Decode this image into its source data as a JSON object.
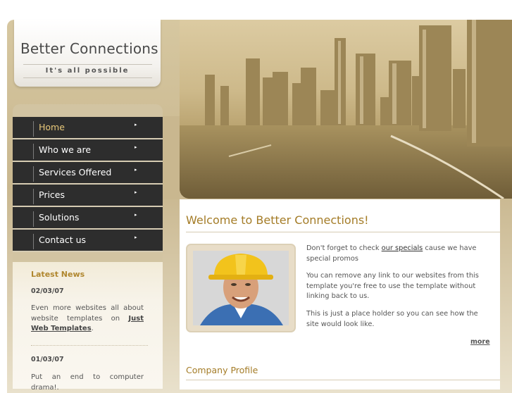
{
  "logo": {
    "title": "Better Connections",
    "tagline": "It's all possible"
  },
  "nav": {
    "items": [
      {
        "label": "Home",
        "active": true
      },
      {
        "label": "Who we are",
        "active": false
      },
      {
        "label": "Services Offered",
        "active": false
      },
      {
        "label": "Prices",
        "active": false
      },
      {
        "label": "Solutions",
        "active": false
      },
      {
        "label": "Contact us",
        "active": false
      }
    ],
    "arrow_glyph": "▸"
  },
  "news": {
    "title": "Latest News",
    "entries": [
      {
        "date": "02/03/07",
        "text_before": "Even more websites all about website templates on ",
        "link": "Just Web Templates",
        "text_after": "."
      },
      {
        "date": "01/03/07",
        "text": "Put an end to computer drama!."
      }
    ]
  },
  "main": {
    "heading": "Welcome to Better Connections!",
    "p1_before": "Don't forget to check ",
    "p1_link": "our specials",
    "p1_after": " cause we have special promos",
    "p2": "You can remove any link to our websites from this template you're free to use the template without linking back to us.",
    "p3": "This is just a place holder so you can see how the site would look like.",
    "more_label": "more",
    "section2_heading": "Company Profile"
  },
  "colors": {
    "accent": "#a47c27",
    "nav_bg": "#2d2d2d",
    "nav_active": "#e8c87a",
    "frame_bg": "#c9b78f"
  }
}
